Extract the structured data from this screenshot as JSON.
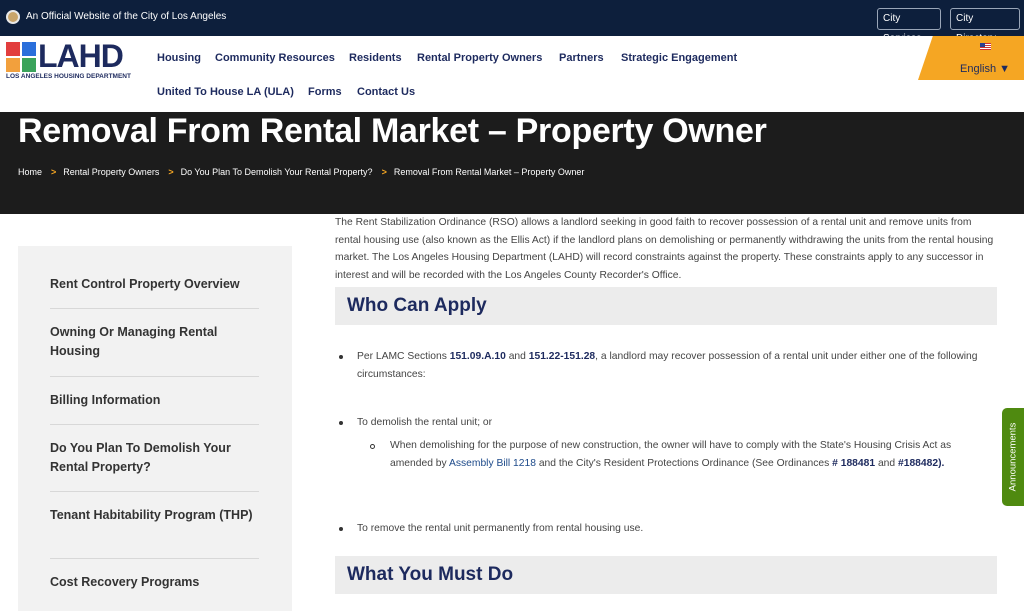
{
  "topbar": {
    "official_text": "An Official Website of the City of Los Angeles",
    "city_services": "City Services",
    "city_directory": "City Directory"
  },
  "logo": {
    "text": "LAHD",
    "subtitle": "LOS ANGELES HOUSING DEPARTMENT"
  },
  "nav": {
    "housing": "Housing",
    "community": "Community Resources",
    "residents": "Residents",
    "owners": "Rental Property Owners",
    "partners": "Partners",
    "strategic": "Strategic Engagement",
    "ula": "United To House LA (ULA)",
    "forms": "Forms",
    "contact": "Contact Us"
  },
  "language": {
    "label": "English ▼"
  },
  "hero": {
    "title": "Removal From Rental Market – Property Owner",
    "breadcrumbs": [
      "Home",
      "Rental Property Owners",
      "Do You Plan To Demolish Your Rental Property?",
      "Removal From Rental Market – Property Owner"
    ],
    "sep": ">"
  },
  "sidebar": {
    "items": [
      "Rent Control Property Overview",
      "Owning Or Managing Rental Housing",
      "Billing Information",
      "Do You Plan To Demolish Your Rental Property?",
      "Tenant Habitability Program (THP)",
      "Cost Recovery Programs"
    ]
  },
  "content": {
    "intro": "The Rent Stabilization Ordinance (RSO) allows a landlord seeking in good faith to recover possession of a rental unit and remove units from rental housing use (also known as the Ellis Act) if the landlord plans on demolishing or permanently withdrawing the units from the rental housing market. The Los Angeles Housing Department (LAHD) will record constraints against the property. These constraints apply to any successor in interest and will be recorded with the Los Angeles County Recorder's Office.",
    "who_can_apply": "Who Can Apply",
    "b1_pre": "Per LAMC Sections ",
    "b1_ref1": "151.09.A.10",
    "b1_and": " and ",
    "b1_ref2": "151.22-151.28",
    "b1_post": ", a landlord may recover possession of a rental unit  under either one of the following circumstances:",
    "b2": "To demolish the rental unit; or",
    "sub_pre": "When demolishing for the purpose of new construction, the owner will have to comply with the State's Housing Crisis Act as amended by ",
    "sub_link": "Assembly Bill 1218",
    "sub_mid": " and the City's Resident Protections Ordinance (See Ordinances ",
    "sub_ord1": "# 188481",
    "sub_and": " and ",
    "sub_ord2": "#188482).",
    "b3": "To remove the rental unit permanently from rental housing use.",
    "what_you_must_do": "What You Must Do"
  },
  "announcements": {
    "label": "Announcements"
  }
}
